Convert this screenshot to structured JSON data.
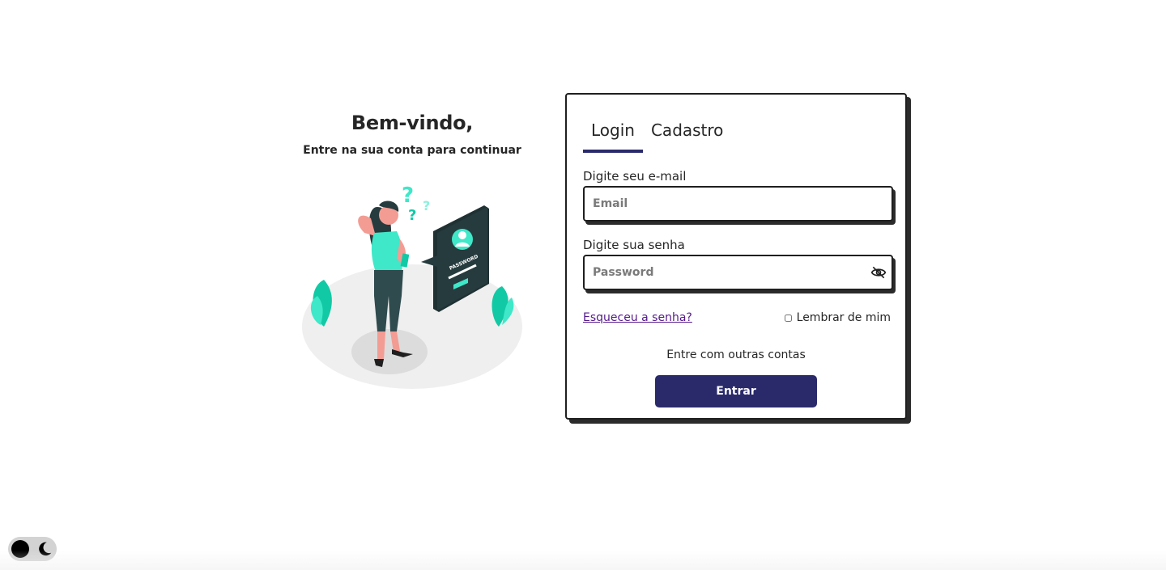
{
  "welcome": {
    "title": "Bem-vindo,",
    "subtitle": "Entre na sua conta para continuar"
  },
  "illustration": {
    "icon": "password-illustration",
    "card_text": "PASSWORD"
  },
  "tabs": [
    {
      "label": "Login",
      "active": true
    },
    {
      "label": "Cadastro",
      "active": false
    }
  ],
  "email": {
    "label": "Digite seu e-mail",
    "placeholder": "Email",
    "value": ""
  },
  "password": {
    "label": "Digite sua senha",
    "placeholder": "Password",
    "value": "",
    "toggle_icon": "eye-off-icon"
  },
  "forgot_link": "Esqueceu a senha?",
  "remember": {
    "label": "Lembrar de mim",
    "checked": false
  },
  "other_accounts": "Entre com outras contas",
  "submit_label": "Entrar",
  "theme_toggle": {
    "icons": [
      "dark-mode-knob",
      "moon-icon"
    ]
  },
  "colors": {
    "accent": "#2a2a6b",
    "link": "#551a8b",
    "illustration_teal": "#3ee8c8",
    "illustration_dark": "#263b3e"
  }
}
